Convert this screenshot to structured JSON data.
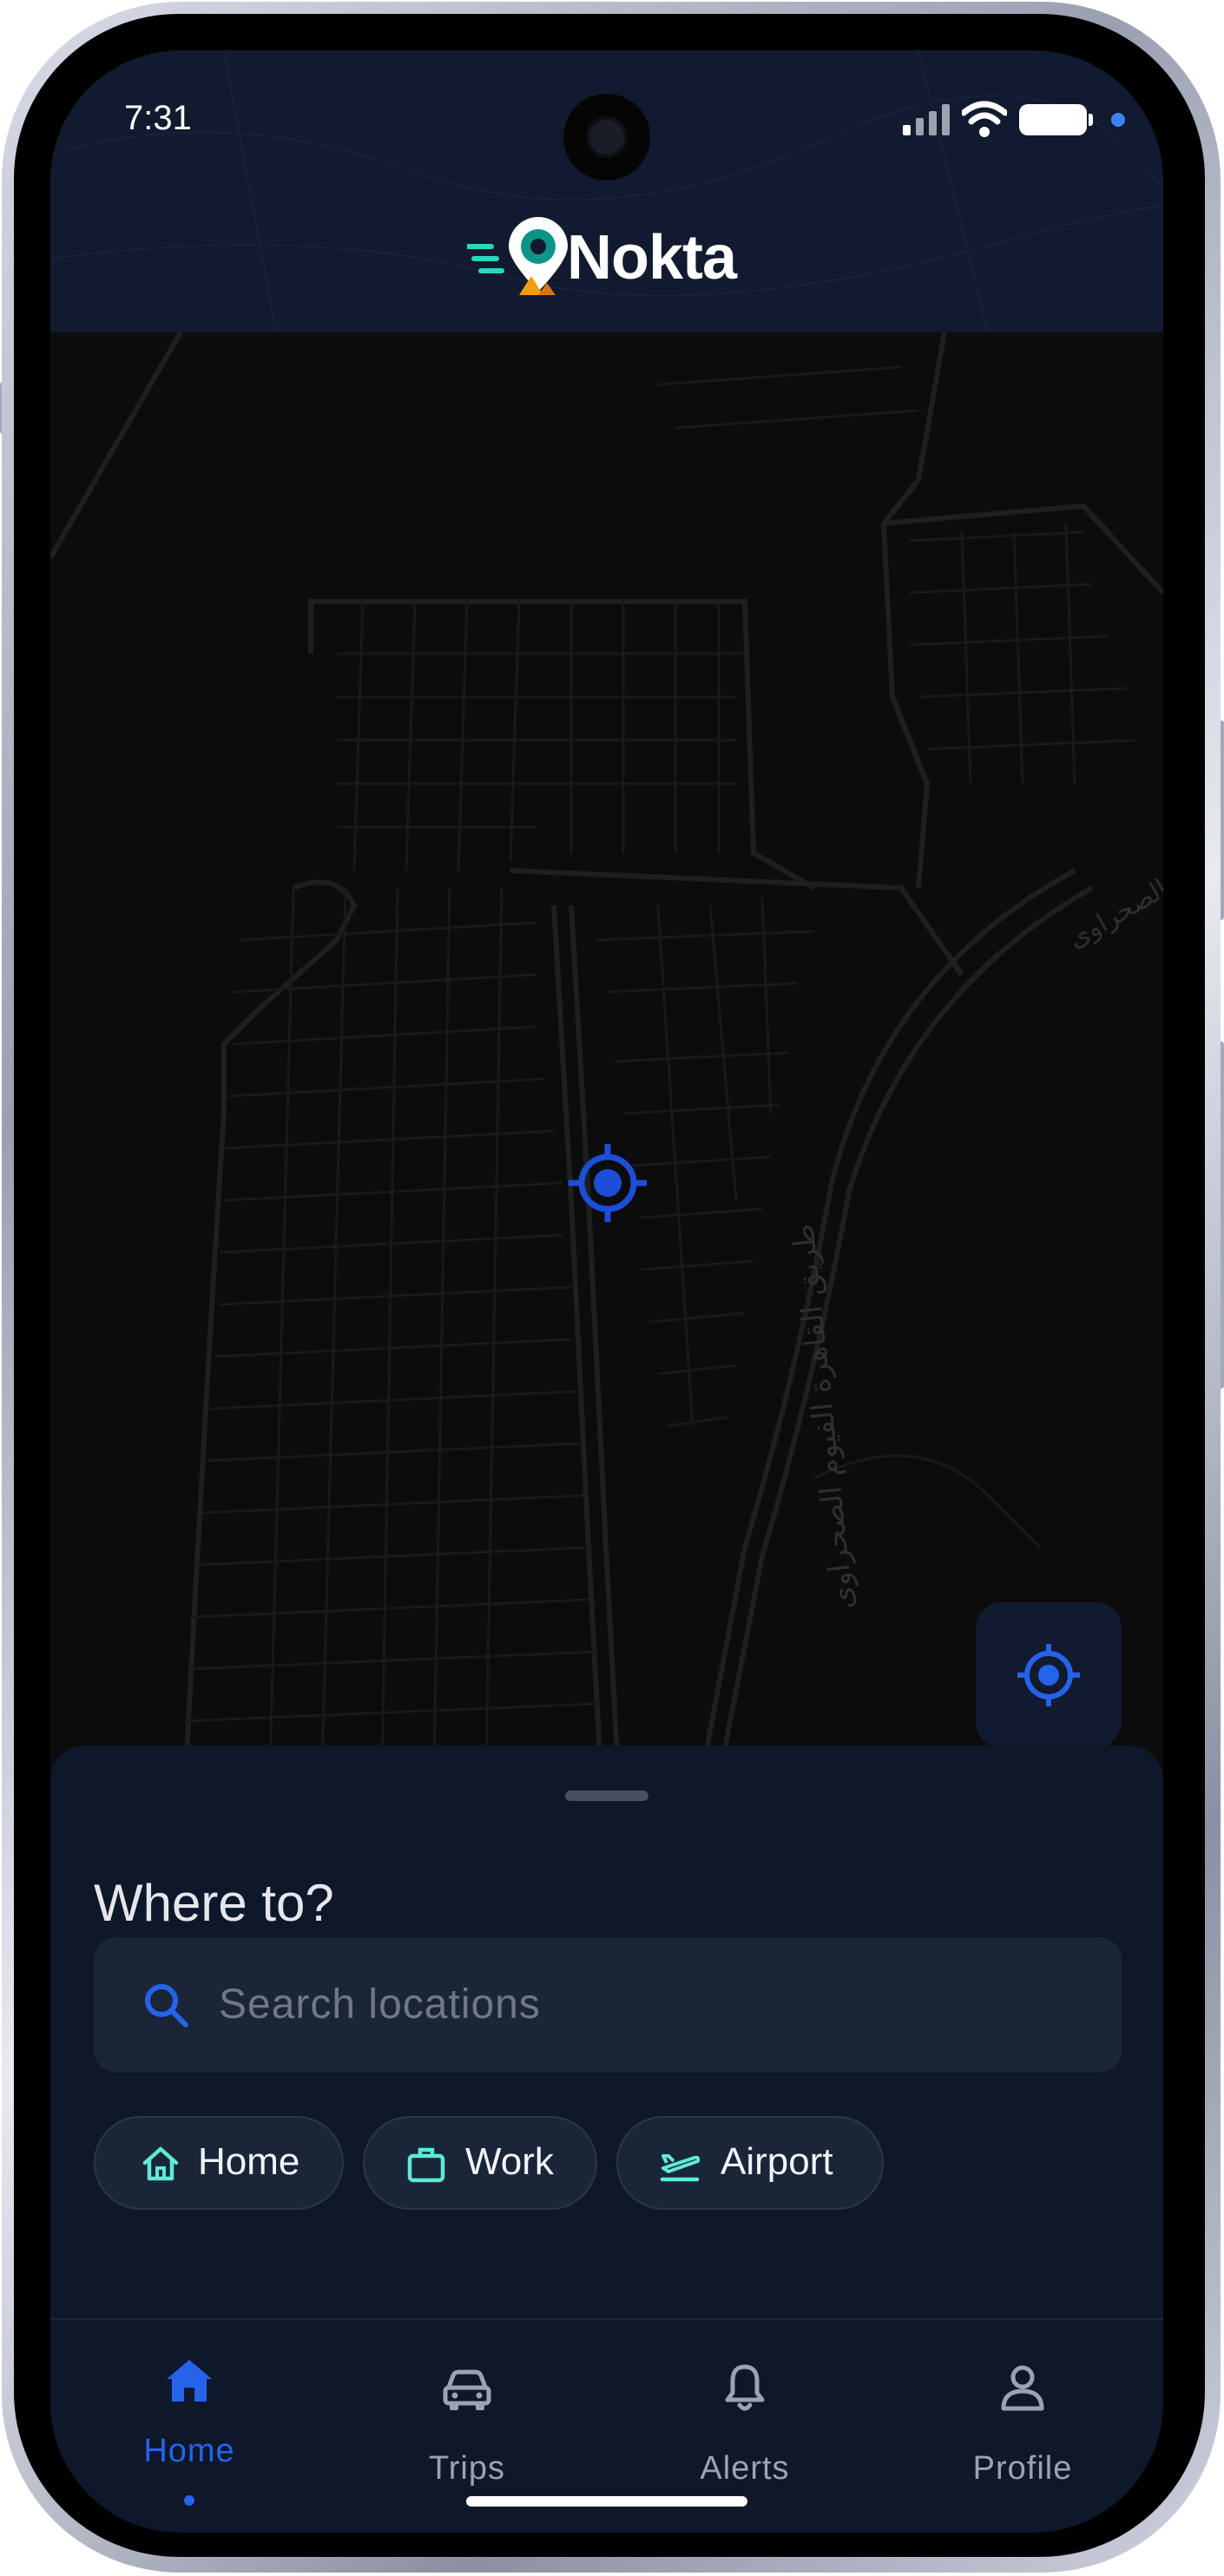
{
  "status_bar": {
    "time": "7:31"
  },
  "app": {
    "logo_text": "Nokta"
  },
  "map": {
    "place_label_1": "طريق القاهرة الفيوم الصحراوى",
    "place_label_2": "الصحراوى"
  },
  "sheet": {
    "title": "Where to?",
    "search": {
      "placeholder": "Search locations"
    },
    "chips": [
      {
        "label": "Home",
        "icon": "home-icon"
      },
      {
        "label": "Work",
        "icon": "briefcase-icon"
      },
      {
        "label": "Airport",
        "icon": "plane-icon"
      }
    ]
  },
  "tabbar": {
    "items": [
      {
        "label": "Home",
        "icon": "home-icon",
        "active": true
      },
      {
        "label": "Trips",
        "icon": "car-icon",
        "active": false
      },
      {
        "label": "Alerts",
        "icon": "bell-icon",
        "active": false
      },
      {
        "label": "Profile",
        "icon": "user-icon",
        "active": false
      }
    ]
  },
  "colors": {
    "accent": "#2563eb",
    "chip_icon": "#5eead4",
    "sheet_bg": "#0f172b",
    "header_bg": "#111a2e"
  }
}
